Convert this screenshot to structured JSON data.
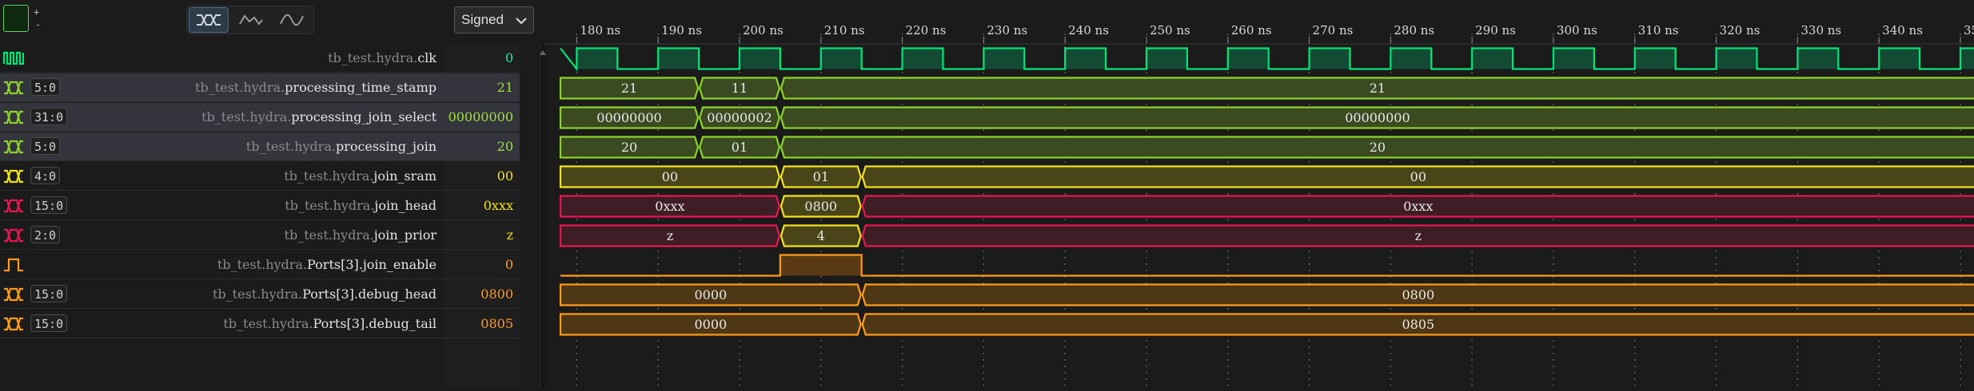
{
  "toolbar": {
    "zoom_in": "+",
    "zoom_out": "-",
    "format_select": "Signed",
    "format_options": [
      "Signed"
    ],
    "shape_buttons": [
      {
        "name": "bus-shape-icon",
        "active": true
      },
      {
        "name": "linear-shape-icon",
        "active": false
      },
      {
        "name": "curve-shape-icon",
        "active": false
      }
    ]
  },
  "timeline": {
    "ticks": [
      {
        "t": 180,
        "label": "180 ns"
      },
      {
        "t": 190,
        "label": "190 ns"
      },
      {
        "t": 200,
        "label": "200 ns"
      },
      {
        "t": 210,
        "label": "210 ns"
      },
      {
        "t": 220,
        "label": "220 ns"
      },
      {
        "t": 230,
        "label": "230 ns"
      },
      {
        "t": 240,
        "label": "240 ns"
      },
      {
        "t": 250,
        "label": "250 ns"
      },
      {
        "t": 260,
        "label": "260 ns"
      },
      {
        "t": 270,
        "label": "270 ns"
      },
      {
        "t": 280,
        "label": "280 ns"
      },
      {
        "t": 290,
        "label": "290 ns"
      },
      {
        "t": 300,
        "label": "300 ns"
      },
      {
        "t": 310,
        "label": "310 ns"
      },
      {
        "t": 320,
        "label": "320 ns"
      },
      {
        "t": 330,
        "label": "330 ns"
      },
      {
        "t": 340,
        "label": "340 ns"
      },
      {
        "t": 350,
        "label": "350 ns"
      }
    ],
    "t_start": 178,
    "t_end": 354
  },
  "signals": [
    {
      "kind": "clock",
      "width": "",
      "scope": "tb_test.hydra.",
      "name": "clk",
      "value": "0",
      "color": "#00e676",
      "fill": "#124a33",
      "valueColor": "#1de9b6",
      "selected": false,
      "clock": {
        "first_rise": 180,
        "period": 10
      }
    },
    {
      "kind": "bus",
      "width": "5:0",
      "scope": "tb_test.hydra.",
      "name": "processing_time_stamp",
      "value": "21",
      "color": "#8bd32a",
      "fill": "#3b4a20",
      "valueColor": "#9ee23b",
      "selected": true,
      "segments": [
        {
          "t0": 178,
          "t1": 195,
          "label": "21"
        },
        {
          "t0": 195,
          "t1": 205,
          "label": "11"
        },
        {
          "t0": 205,
          "t1": 354,
          "label": "21"
        }
      ]
    },
    {
      "kind": "bus",
      "width": "31:0",
      "scope": "tb_test.hydra.",
      "name": "processing_join_select",
      "value": "00000000",
      "color": "#8bd32a",
      "fill": "#3b4a20",
      "valueColor": "#9ee23b",
      "selected": true,
      "segments": [
        {
          "t0": 178,
          "t1": 195,
          "label": "00000000"
        },
        {
          "t0": 195,
          "t1": 205,
          "label": "00000002"
        },
        {
          "t0": 205,
          "t1": 354,
          "label": "00000000"
        }
      ]
    },
    {
      "kind": "bus",
      "width": "5:0",
      "scope": "tb_test.hydra.",
      "name": "processing_join",
      "value": "20",
      "color": "#8bd32a",
      "fill": "#3b4a20",
      "valueColor": "#9ee23b",
      "selected": true,
      "segments": [
        {
          "t0": 178,
          "t1": 195,
          "label": "20"
        },
        {
          "t0": 195,
          "t1": 205,
          "label": "01"
        },
        {
          "t0": 205,
          "t1": 354,
          "label": "20"
        }
      ]
    },
    {
      "kind": "bus",
      "width": "4:0",
      "scope": "tb_test.hydra.",
      "name": "join_sram",
      "value": "00",
      "color": "#f2e21e",
      "fill": "#4a4519",
      "valueColor": "#f2e21e",
      "selected": false,
      "segments": [
        {
          "t0": 178,
          "t1": 205,
          "label": "00"
        },
        {
          "t0": 205,
          "t1": 215,
          "label": "01"
        },
        {
          "t0": 215,
          "t1": 354,
          "label": "00"
        }
      ]
    },
    {
      "kind": "bus",
      "width": "15:0",
      "scope": "tb_test.hydra.",
      "name": "join_head",
      "value": "0xxx",
      "color": "#e8174f",
      "fill": "#3e1d27",
      "valueColor": "#f2e21e",
      "selected": false,
      "segments": [
        {
          "t0": 178,
          "t1": 205,
          "label": "0xxx"
        },
        {
          "t0": 205,
          "t1": 215,
          "label": "0800",
          "color": "#f2e21e",
          "fill": "#4a4519"
        },
        {
          "t0": 215,
          "t1": 354,
          "label": "0xxx"
        }
      ]
    },
    {
      "kind": "bus",
      "width": "2:0",
      "scope": "tb_test.hydra.",
      "name": "join_prior",
      "value": "z",
      "color": "#e8174f",
      "fill": "#3e1d27",
      "valueColor": "#f2e21e",
      "selected": false,
      "segments": [
        {
          "t0": 178,
          "t1": 205,
          "label": "z"
        },
        {
          "t0": 205,
          "t1": 215,
          "label": "4",
          "color": "#f2e21e",
          "fill": "#4a4519"
        },
        {
          "t0": 215,
          "t1": 354,
          "label": "z"
        }
      ]
    },
    {
      "kind": "bit",
      "width": "",
      "scope": "tb_test.hydra.",
      "name": "Ports[3].join_enable",
      "value": "0",
      "color": "#ff9a1a",
      "fill": "#5a3a14",
      "valueColor": "#ff9a1a",
      "selected": false,
      "levels": [
        {
          "t0": 178,
          "t1": 205,
          "v": 0
        },
        {
          "t0": 205,
          "t1": 215,
          "v": 1
        },
        {
          "t0": 215,
          "t1": 354,
          "v": 0
        }
      ]
    },
    {
      "kind": "bus",
      "width": "15:0",
      "scope": "tb_test.hydra.",
      "name": "Ports[3].debug_head",
      "value": "0800",
      "color": "#ff9a1a",
      "fill": "#4d3714",
      "valueColor": "#ff9a1a",
      "selected": false,
      "segments": [
        {
          "t0": 178,
          "t1": 215,
          "label": "0000"
        },
        {
          "t0": 215,
          "t1": 354,
          "label": "0800"
        }
      ]
    },
    {
      "kind": "bus",
      "width": "15:0",
      "scope": "tb_test.hydra.",
      "name": "Ports[3].debug_tail",
      "value": "0805",
      "color": "#ff9a1a",
      "fill": "#4d3714",
      "valueColor": "#ff9a1a",
      "selected": false,
      "segments": [
        {
          "t0": 178,
          "t1": 215,
          "label": "0000"
        },
        {
          "t0": 215,
          "t1": 354,
          "label": "0805"
        }
      ]
    }
  ]
}
